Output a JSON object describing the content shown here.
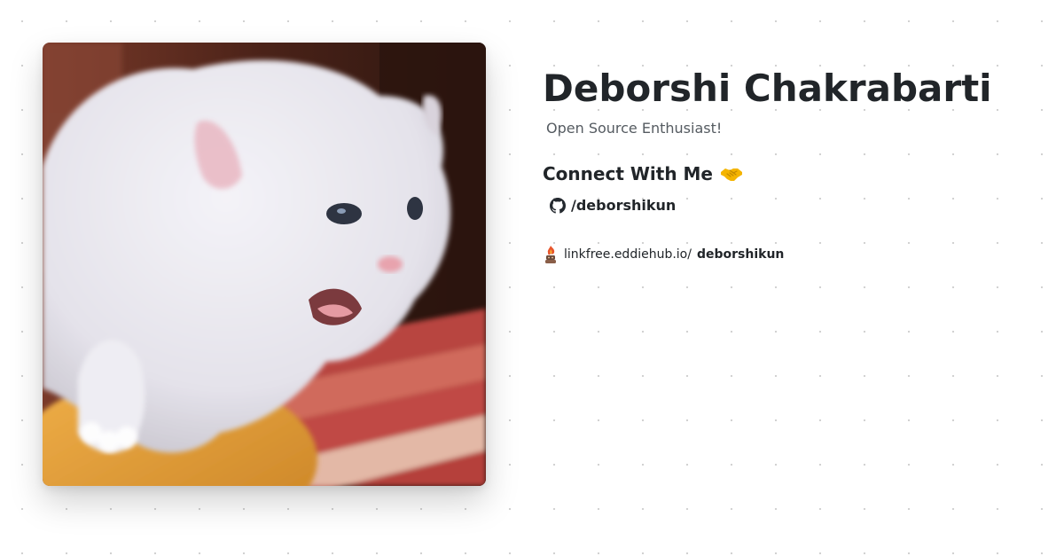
{
  "profile": {
    "name": "Deborshi Chakrabarti",
    "tagline": "Open Source Enthusiast!",
    "avatar_icon": "white-kitten-photo"
  },
  "connect": {
    "heading": "Connect With Me",
    "heading_icon": "handshake-icon",
    "links": [
      {
        "icon": "github-icon",
        "label": "/deborshikun"
      }
    ]
  },
  "footer": {
    "icon": "linkfree-logo-icon",
    "host": "linkfree.eddiehub.io/",
    "username": "deborshikun"
  },
  "colors": {
    "background": "#ffffff",
    "dot_grid": "#cfcfcf",
    "text_primary": "#212529",
    "text_secondary": "#555b61",
    "handshake": "#f4b400",
    "linkfree_accent": "#e8552d"
  }
}
